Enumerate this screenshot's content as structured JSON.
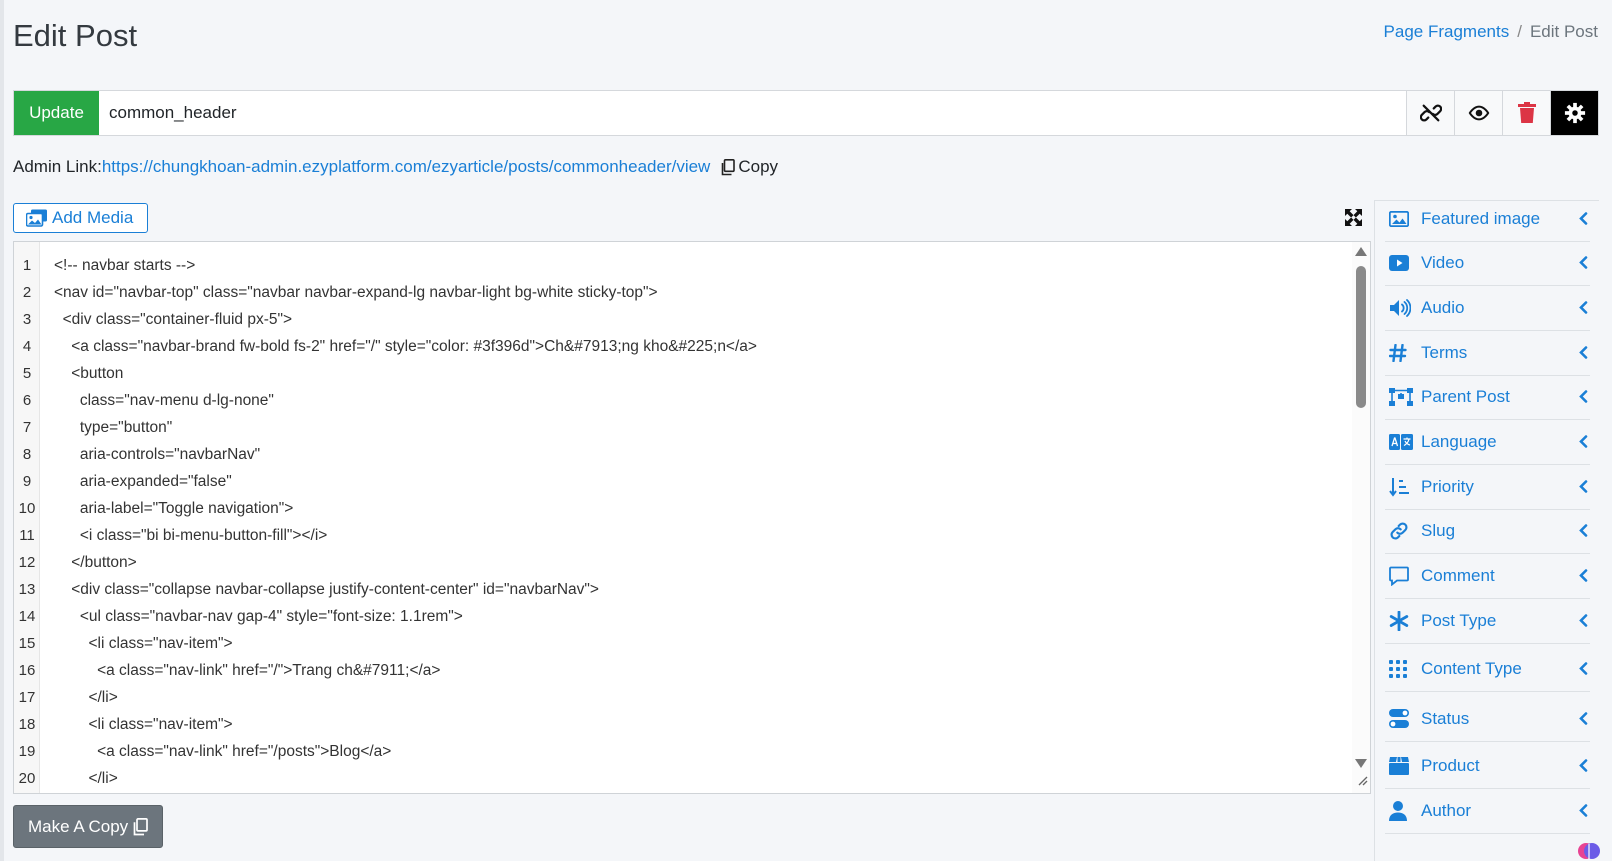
{
  "page": {
    "title": "Edit Post"
  },
  "breadcrumb": {
    "parent": "Page Fragments",
    "separator": "/",
    "current": "Edit Post"
  },
  "toolbar": {
    "update_label": "Update",
    "title_value": "common_header"
  },
  "admin": {
    "label": "Admin Link:",
    "url": "https://chungkhoan-admin.ezyplatform.com/ezyarticle/posts/commonheader/view",
    "copy_label": "Copy"
  },
  "media": {
    "add_label": "Add Media"
  },
  "editor": {
    "lines": [
      {
        "n": "1",
        "code": "<!-- navbar starts -->"
      },
      {
        "n": "2",
        "code": "<nav id=\"navbar-top\" class=\"navbar navbar-expand-lg navbar-light bg-white sticky-top\">"
      },
      {
        "n": "3",
        "code": "  <div class=\"container-fluid px-5\">"
      },
      {
        "n": "4",
        "code": "    <a class=\"navbar-brand fw-bold fs-2\" href=\"/\" style=\"color: #3f396d\">Ch&#7913;ng kho&#225;n</a>"
      },
      {
        "n": "5",
        "code": "    <button"
      },
      {
        "n": "6",
        "code": "      class=\"nav-menu d-lg-none\""
      },
      {
        "n": "7",
        "code": "      type=\"button\""
      },
      {
        "n": "8",
        "code": "      aria-controls=\"navbarNav\""
      },
      {
        "n": "9",
        "code": "      aria-expanded=\"false\""
      },
      {
        "n": "10",
        "code": "      aria-label=\"Toggle navigation\">"
      },
      {
        "n": "11",
        "code": "      <i class=\"bi bi-menu-button-fill\"></i>"
      },
      {
        "n": "12",
        "code": "    </button>"
      },
      {
        "n": "13",
        "code": "    <div class=\"collapse navbar-collapse justify-content-center\" id=\"navbarNav\">"
      },
      {
        "n": "14",
        "code": "      <ul class=\"navbar-nav gap-4\" style=\"font-size: 1.1rem\">"
      },
      {
        "n": "15",
        "code": "        <li class=\"nav-item\">"
      },
      {
        "n": "16",
        "code": "          <a class=\"nav-link\" href=\"/\">Trang ch&#7911;</a>"
      },
      {
        "n": "17",
        "code": "        </li>"
      },
      {
        "n": "18",
        "code": "        <li class=\"nav-item\">"
      },
      {
        "n": "19",
        "code": "          <a class=\"nav-link\" href=\"/posts\">Blog</a>"
      },
      {
        "n": "20",
        "code": "        </li>"
      }
    ]
  },
  "make_copy": {
    "label": "Make A Copy"
  },
  "sidebar": {
    "items": [
      {
        "label": "Featured image",
        "icon": "image-icon"
      },
      {
        "label": "Video",
        "icon": "video-icon"
      },
      {
        "label": "Audio",
        "icon": "audio-icon"
      },
      {
        "label": "Terms",
        "icon": "hashtag-icon"
      },
      {
        "label": "Parent Post",
        "icon": "hierarchy-icon"
      },
      {
        "label": "Language",
        "icon": "language-icon"
      },
      {
        "label": "Priority",
        "icon": "sort-icon"
      },
      {
        "label": "Slug",
        "icon": "link-icon"
      },
      {
        "label": "Comment",
        "icon": "comment-icon"
      },
      {
        "label": "Post Type",
        "icon": "asterisk-icon"
      },
      {
        "label": "Content Type",
        "icon": "grid-icon"
      },
      {
        "label": "Status",
        "icon": "toggle-icon"
      },
      {
        "label": "Product",
        "icon": "box-icon"
      },
      {
        "label": "Author",
        "icon": "user-icon"
      }
    ]
  },
  "colors": {
    "accent": "#1a7fd6",
    "update": "#28a745",
    "delete": "#dc3545",
    "secondary": "#6c757d",
    "background": "#f4f6f9"
  }
}
